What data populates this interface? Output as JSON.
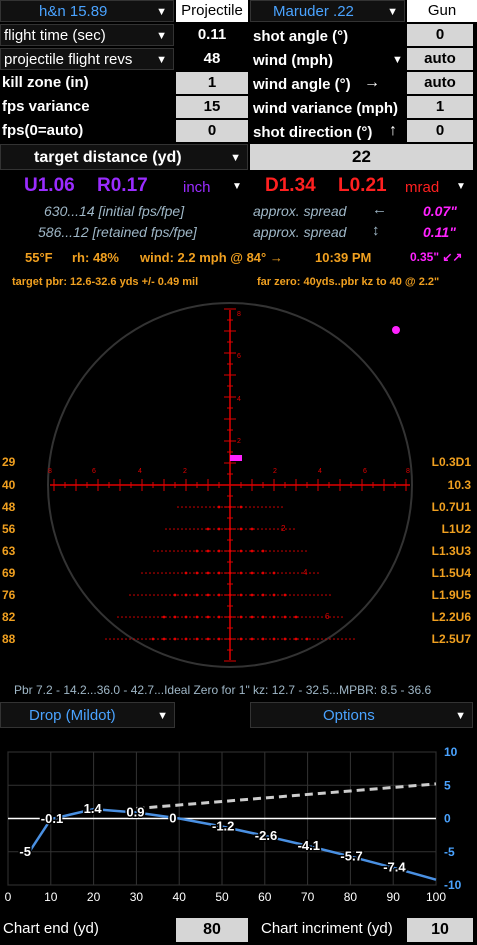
{
  "top": {
    "rifle": "h&n 15.89",
    "projectile_hdr": "Projectile",
    "gun": "Maruder .22",
    "gun_hdr": "Gun"
  },
  "left_rows": [
    {
      "label": "flight time (sec)",
      "value": "0.11"
    },
    {
      "label": "projectile flight revs",
      "value": "48"
    },
    {
      "label": "kill zone (in)",
      "value": "1"
    },
    {
      "label": "fps variance",
      "value": "15"
    },
    {
      "label": "fps(0=auto)",
      "value": "0"
    }
  ],
  "right_rows": [
    {
      "label": "shot angle (°)",
      "value": "0"
    },
    {
      "label": "wind (mph)",
      "value": "auto"
    },
    {
      "label": "wind angle (°)",
      "arrow": "→",
      "value": "auto"
    },
    {
      "label": "wind variance (mph)",
      "value": "1"
    },
    {
      "label": "shot direction (°)",
      "arrow": "↑",
      "value": "0"
    }
  ],
  "target": {
    "label": "target distance (yd)",
    "value": "22"
  },
  "holds": {
    "u": "U1.06",
    "r": "R0.17",
    "unit1": "inch",
    "d": "D1.34",
    "l": "L0.21",
    "unit2": "mrad"
  },
  "info": {
    "initial": "630...14 [initial fps/fpe]",
    "retained": "586...12 [retained fps/fpe]",
    "spread_label": "approx. spread",
    "arrow_h": "←",
    "arrow_v": "↕",
    "spread1": "0.07\"",
    "spread2": "0.11\""
  },
  "weather": {
    "temp": "55°F",
    "rh": "rh: 48%",
    "wind": "wind: 2.2 mph @ 84° →",
    "time": "10:39 PM",
    "drift": "0.35\" ↙↗"
  },
  "pbr_line": {
    "left": "target pbr: 12.6-32.6 yds  +/- 0.49 mil",
    "right": "far zero: 40yds..pbr kz to 40 @ 2.2\""
  },
  "reticle": {
    "left_ranges": [
      "29",
      "40",
      "48",
      "56",
      "63",
      "69",
      "76",
      "82",
      "88"
    ],
    "right_holds": [
      "L0.3D1",
      "10.3",
      "L0.7U1",
      "L1U2",
      "L1.3U3",
      "L1.5U4",
      "L1.9U5",
      "L2.2U6",
      "L2.5U7"
    ],
    "v_ticks": [
      "8",
      "6",
      "4",
      "2"
    ],
    "h_ticks_left": [
      "8",
      "6",
      "4",
      "2"
    ],
    "h_ticks_right": [
      "2",
      "4",
      "6",
      "8"
    ],
    "tree_labels": [
      "2",
      "4",
      "6"
    ]
  },
  "summary": "Pbr 7.2 - 14.2...36.0 - 42.7...Ideal Zero for 1\" kz: 12.7 - 32.5...MPBR: 8.5 - 36.6",
  "buttons": {
    "drop": "Drop (Mildot)",
    "options": "Options"
  },
  "chart_data": {
    "type": "line",
    "x": [
      5,
      10,
      20,
      30,
      40,
      50,
      60,
      70,
      80,
      90,
      100
    ],
    "series": [
      {
        "values": [
          -5,
          -0.1,
          1.4,
          0.9,
          0,
          -1.2,
          -2.6,
          -4.1,
          -5.7,
          -7.4,
          -9.2
        ]
      }
    ],
    "point_labels": [
      {
        "x": 5,
        "y": -5,
        "text": "-5"
      },
      {
        "x": 10,
        "y": -0.1,
        "text": "-0.1"
      },
      {
        "x": 20,
        "y": 1.4,
        "text": "1.4"
      },
      {
        "x": 30,
        "y": 0.9,
        "text": "0.9"
      },
      {
        "x": 40,
        "y": 0,
        "text": "0"
      },
      {
        "x": 50,
        "y": -1.2,
        "text": "-1.2"
      },
      {
        "x": 60,
        "y": -2.6,
        "text": "-2.6"
      },
      {
        "x": 70,
        "y": -4.1,
        "text": "-4.1"
      },
      {
        "x": 80,
        "y": -5.7,
        "text": "-5.7"
      },
      {
        "x": 90,
        "y": -7.4,
        "text": "-7.4"
      }
    ],
    "xlim": [
      0,
      100
    ],
    "ylim": [
      -10,
      10
    ],
    "xticks": [
      "0",
      "10",
      "20",
      "30",
      "40",
      "50",
      "60",
      "70",
      "80",
      "90",
      "100"
    ],
    "yticks": [
      "10",
      "5",
      "0",
      "-5",
      "-10"
    ],
    "grid": true
  },
  "chart_ctrl": {
    "end_label": "Chart end (yd)",
    "end_value": "80",
    "inc_label": "Chart incriment (yd)",
    "inc_value": "10"
  },
  "colors": {
    "accent": "#4aa3ff",
    "reticle": "#e00000",
    "orange": "#f0a020",
    "magenta": "#ff22ff",
    "purple": "#9a2cff",
    "red": "#ff2020"
  }
}
